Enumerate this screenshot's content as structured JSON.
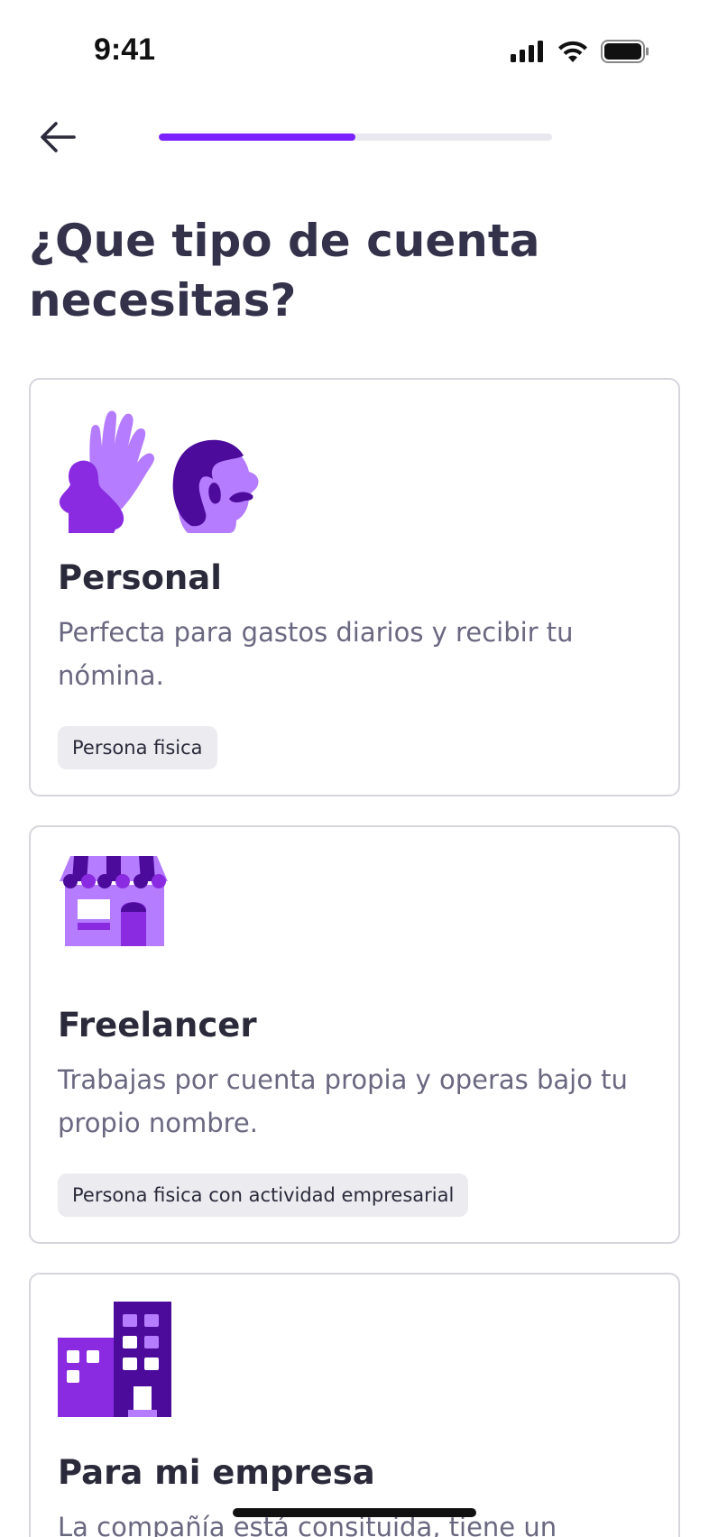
{
  "status_bar": {
    "time": "9:41"
  },
  "header": {
    "progress_fraction": 0.5
  },
  "title": "¿Que tipo de cuenta necesitas?",
  "account_types": [
    {
      "title": "Personal",
      "description": "Perfecta para gastos diarios y recibir tu nómina.",
      "tag": "Persona fisica",
      "illustration": "hand-and-person-icon"
    },
    {
      "title": "Freelancer",
      "description": "Trabajas por cuenta propia y operas bajo tu propio nombre.",
      "tag": "Persona fisica con actividad empresarial",
      "illustration": "storefront-icon"
    },
    {
      "title": "Para mi empresa",
      "description": "La compañía está consituida, tiene un",
      "illustration": "office-buildings-icon"
    }
  ],
  "colors": {
    "accent": "#7b22ff",
    "illus_light": "#b57cff",
    "illus_mid": "#8a2be2",
    "illus_dark": "#4d0b9c",
    "title_text": "#34324a",
    "body_text": "#6a6880",
    "chip_bg": "#ebebf0",
    "card_border": "#d6d5dd"
  }
}
